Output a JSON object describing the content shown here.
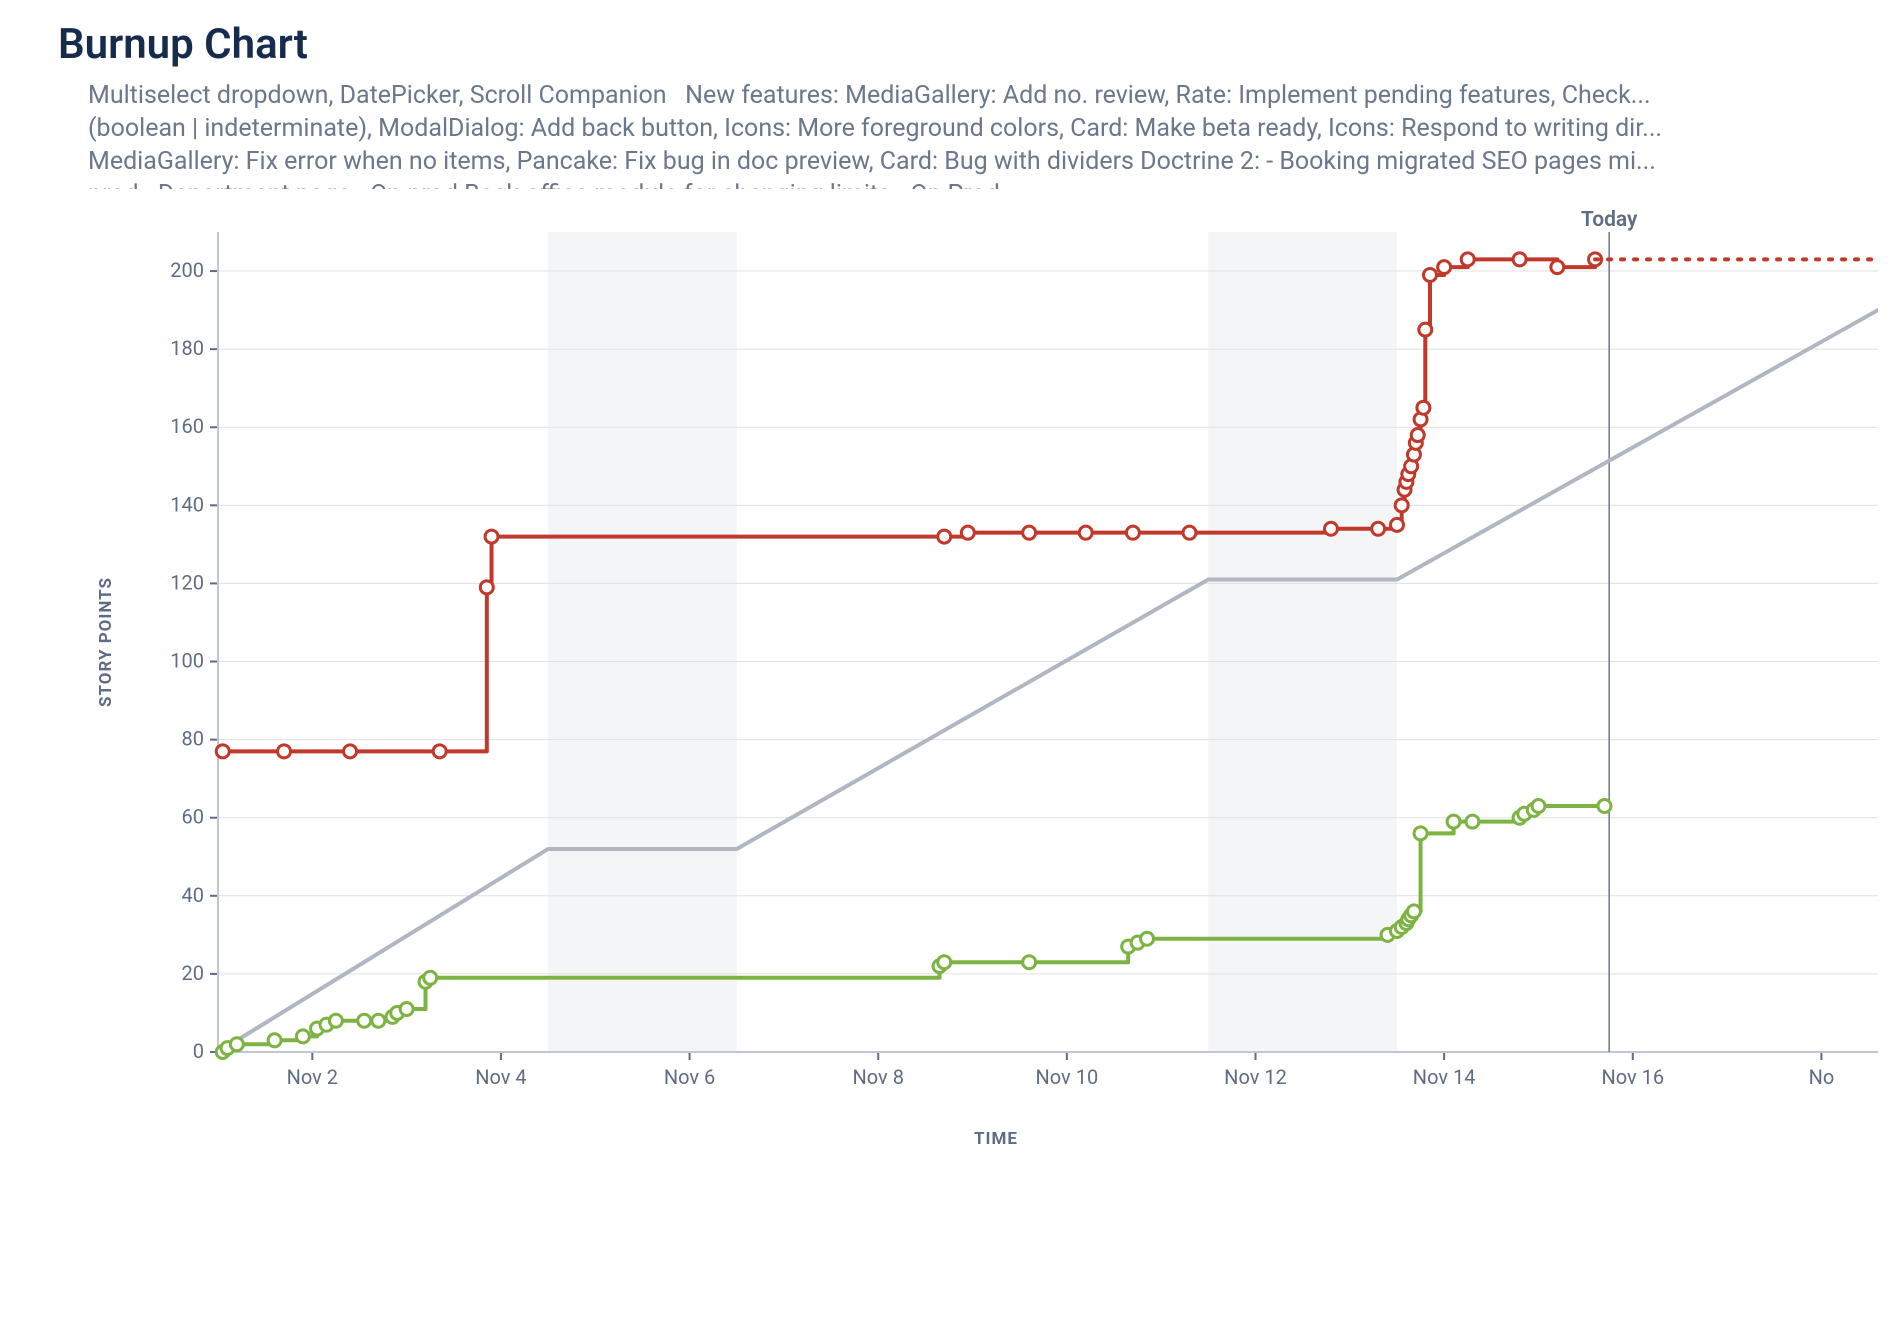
{
  "title": "Burnup Chart",
  "description_text": "Multiselect dropdown, DatePicker, Scroll Companion   New features: MediaGallery: Add no. review, Rate: Implement pending features, Check...\n(boolean | indeterminate), ModalDialog: Add back button, Icons: More foreground colors, Card: Make beta ready, Icons: Respond to writing dir...\nMediaGallery: Fix error when no items, Pancake: Fix bug in doc preview, Card: Bug with dividers Doctrine 2: - Booking migrated SEO pages mi...\nprod - Department page - On prod Back-office module for changing limits - On Prod",
  "today_label": "Today",
  "chart_data": {
    "type": "line",
    "xlabel": "TIME",
    "ylabel": "STORY POINTS",
    "ylim": [
      0,
      210
    ],
    "ytick_labels": [
      "0",
      "20",
      "40",
      "60",
      "80",
      "100",
      "120",
      "140",
      "160",
      "180",
      "200"
    ],
    "xtick_labels": [
      "Nov 2",
      "Nov 4",
      "Nov 6",
      "Nov 8",
      "Nov 10",
      "Nov 12",
      "Nov 14",
      "Nov 16",
      "No"
    ],
    "x_domain_days": [
      0,
      17.6
    ],
    "today_x": 14.75,
    "weekend_bands": [
      [
        3.5,
        5.5
      ],
      [
        10.5,
        12.5
      ]
    ],
    "colors": {
      "scope": "#c0392b",
      "done": "#7cb342",
      "ideal": "#b0b7c3",
      "grid": "#dfe1e6",
      "weekend": "#f4f5f7",
      "today": "#6b778c"
    },
    "series": [
      {
        "name": "ideal",
        "step": false,
        "markers": false,
        "style": "solid",
        "points": [
          [
            0,
            0
          ],
          [
            3.5,
            52
          ],
          [
            5.5,
            52
          ],
          [
            10.5,
            121
          ],
          [
            12.5,
            121
          ],
          [
            17.6,
            190
          ]
        ]
      },
      {
        "name": "scope",
        "step": true,
        "markers": true,
        "style": "solid",
        "points": [
          [
            0.05,
            77
          ],
          [
            0.7,
            77
          ],
          [
            1.4,
            77
          ],
          [
            2.35,
            77
          ],
          [
            2.85,
            119
          ],
          [
            2.9,
            132
          ],
          [
            7.7,
            132
          ],
          [
            7.95,
            133
          ],
          [
            8.6,
            133
          ],
          [
            9.2,
            133
          ],
          [
            9.7,
            133
          ],
          [
            10.3,
            133
          ],
          [
            11.8,
            134
          ],
          [
            12.3,
            134
          ],
          [
            12.5,
            135
          ],
          [
            12.55,
            140
          ],
          [
            12.58,
            144
          ],
          [
            12.6,
            146
          ],
          [
            12.62,
            148
          ],
          [
            12.65,
            150
          ],
          [
            12.68,
            153
          ],
          [
            12.7,
            156
          ],
          [
            12.72,
            158
          ],
          [
            12.75,
            162
          ],
          [
            12.78,
            165
          ],
          [
            12.8,
            185
          ],
          [
            12.85,
            199
          ],
          [
            13.0,
            201
          ],
          [
            13.25,
            203
          ],
          [
            13.8,
            203
          ],
          [
            14.2,
            201
          ],
          [
            14.6,
            203
          ]
        ]
      },
      {
        "name": "scope_future",
        "step": false,
        "markers": false,
        "style": "dotted",
        "points": [
          [
            14.6,
            203
          ],
          [
            17.6,
            203
          ]
        ]
      },
      {
        "name": "done",
        "step": true,
        "markers": true,
        "style": "solid",
        "points": [
          [
            0.05,
            0
          ],
          [
            0.1,
            1
          ],
          [
            0.2,
            2
          ],
          [
            0.6,
            3
          ],
          [
            0.9,
            4
          ],
          [
            1.05,
            6
          ],
          [
            1.15,
            7
          ],
          [
            1.25,
            8
          ],
          [
            1.55,
            8
          ],
          [
            1.7,
            8
          ],
          [
            1.85,
            9
          ],
          [
            1.9,
            10
          ],
          [
            2.0,
            11
          ],
          [
            2.2,
            18
          ],
          [
            2.25,
            19
          ],
          [
            7.65,
            22
          ],
          [
            7.7,
            23
          ],
          [
            8.6,
            23
          ],
          [
            9.65,
            27
          ],
          [
            9.75,
            28
          ],
          [
            9.85,
            29
          ],
          [
            12.4,
            30
          ],
          [
            12.5,
            31
          ],
          [
            12.55,
            32
          ],
          [
            12.6,
            33
          ],
          [
            12.62,
            34
          ],
          [
            12.65,
            35
          ],
          [
            12.68,
            36
          ],
          [
            12.75,
            56
          ],
          [
            13.1,
            59
          ],
          [
            13.3,
            59
          ],
          [
            13.8,
            60
          ],
          [
            13.85,
            61
          ],
          [
            13.95,
            62
          ],
          [
            14.0,
            63
          ],
          [
            14.7,
            63
          ]
        ]
      }
    ]
  }
}
